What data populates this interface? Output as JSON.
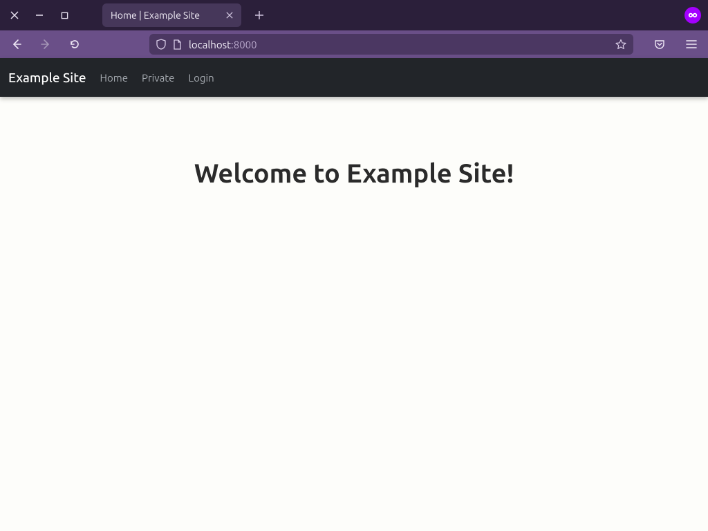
{
  "titlebar": {
    "tab_title": "Home | Example Site"
  },
  "toolbar": {
    "url_host": "localhost",
    "url_port": ":8000"
  },
  "page": {
    "brand": "Example Site",
    "nav": {
      "home": "Home",
      "private": "Private",
      "login": "Login"
    },
    "headline": "Welcome to Example Site!"
  }
}
